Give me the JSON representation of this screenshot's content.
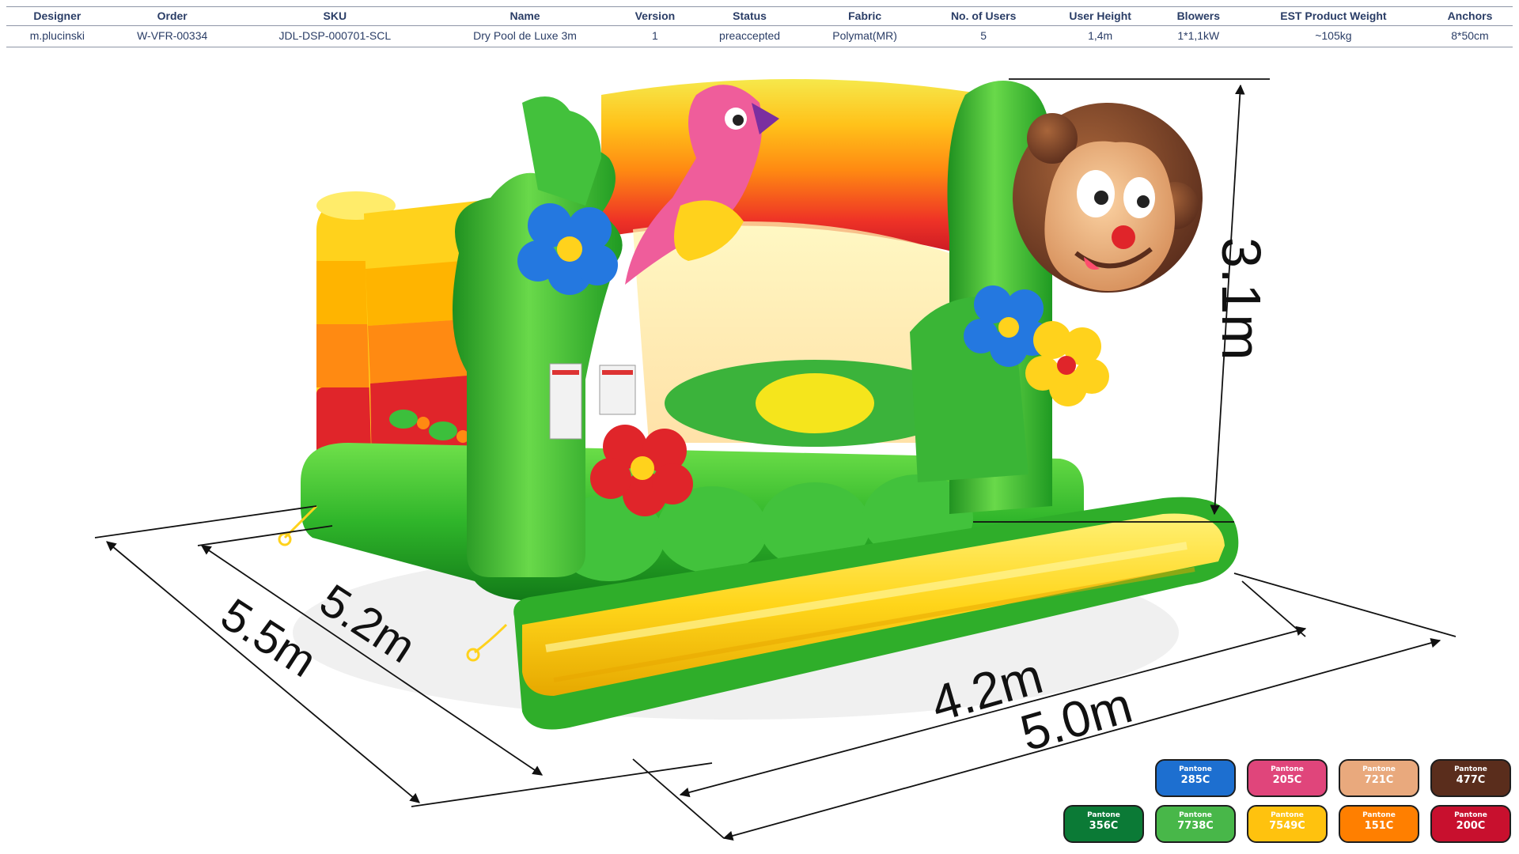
{
  "header": {
    "columns": [
      "Designer",
      "Order",
      "SKU",
      "Name",
      "Version",
      "Status",
      "Fabric",
      "No. of Users",
      "User  Height",
      "Blowers",
      "EST Product Weight",
      "Anchors"
    ],
    "values": [
      "m.plucinski",
      "W-VFR-00334",
      "JDL-DSP-000701-SCL",
      "Dry Pool de Luxe 3m",
      "1",
      "preaccepted",
      "Polymat(MR)",
      "5",
      "1,4m",
      "1*1,1kW",
      "~105kg",
      "8*50cm"
    ]
  },
  "dimensions": {
    "height": "3.1m",
    "outer_depth": "5.5m",
    "inner_depth": "5.2m",
    "inner_width": "4.2m",
    "outer_width": "5.0m"
  },
  "swatches": [
    {
      "label": "Pantone",
      "code": "285C",
      "color": "#1d6fd0"
    },
    {
      "label": "Pantone",
      "code": "205C",
      "color": "#e0457b"
    },
    {
      "label": "Pantone",
      "code": "721C",
      "color": "#e9a97d"
    },
    {
      "label": "Pantone",
      "code": "477C",
      "color": "#5a2d1c"
    },
    {
      "label": "Pantone",
      "code": "356C",
      "color": "#0b7a36"
    },
    {
      "label": "Pantone",
      "code": "7738C",
      "color": "#48b749"
    },
    {
      "label": "Pantone",
      "code": "7549C",
      "color": "#ffc20e"
    },
    {
      "label": "Pantone",
      "code": "151C",
      "color": "#ff7f00"
    },
    {
      "label": "Pantone",
      "code": "200C",
      "color": "#c8102e"
    }
  ]
}
